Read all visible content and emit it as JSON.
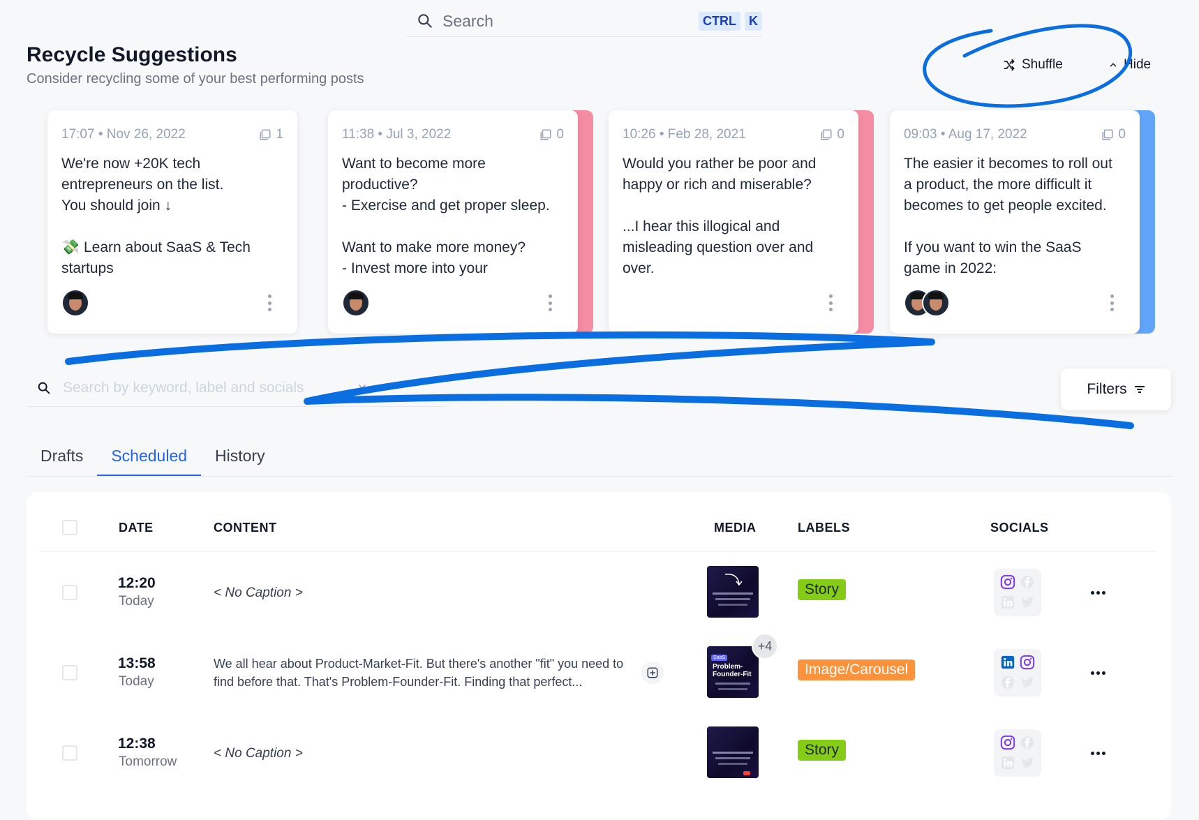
{
  "topbar": {
    "search_placeholder": "Search",
    "shortcut_key1": "CTRL",
    "shortcut_key2": "K"
  },
  "recycle": {
    "title": "Recycle Suggestions",
    "subtitle": "Consider recycling some of your best performing posts",
    "shuffle_label": "Shuffle",
    "hide_label": "Hide",
    "cards": [
      {
        "meta": "17:07 • Nov 26, 2022",
        "media_count": "1",
        "text": "We're now +20K tech\nentrepreneurs on the list.\nYou should join ↓\n\n💸 Learn about SaaS & Tech\nstartups",
        "accent": ""
      },
      {
        "meta": "11:38 • Jul 3, 2022",
        "media_count": "0",
        "text": "Want to become more\nproductive?\n- Exercise and get proper sleep.\n\nWant to make more money?\n- Invest more into your",
        "accent": "#f48ca3"
      },
      {
        "meta": "10:26 • Feb 28, 2021",
        "media_count": "0",
        "text": "Would you rather be poor and\nhappy or rich and miserable?\n\n...I hear this illogical and\nmisleading question over and\nover.",
        "accent": "#f48ca3"
      },
      {
        "meta": "09:03 • Aug 17, 2022",
        "media_count": "0",
        "text": "The easier it becomes to roll out\na product, the more difficult it\nbecomes to get people excited.\n\nIf you want to win the SaaS\ngame in 2022:",
        "accent": "#60a5fa"
      }
    ]
  },
  "list_search": {
    "placeholder": "Search by keyword, label and socials"
  },
  "filters_label": "Filters",
  "tabs": [
    {
      "label": "Drafts"
    },
    {
      "label": "Scheduled"
    },
    {
      "label": "History"
    }
  ],
  "table": {
    "headers": {
      "date": "DATE",
      "content": "CONTENT",
      "media": "MEDIA",
      "labels": "LABELS",
      "socials": "SOCIALS"
    },
    "rows": [
      {
        "time": "12:20",
        "day": "Today",
        "content": "< No Caption >",
        "label": "Story"
      },
      {
        "time": "13:58",
        "day": "Today",
        "content": "We all hear about Product-Market-Fit. But there's another \"fit\" you need to find before that. That's Problem-Founder-Fit. Finding that perfect...",
        "label": "Image/Carousel",
        "media_extra": "+4",
        "media_title": "Problem-Founder-Fit",
        "media_tag": "SaaS"
      },
      {
        "time": "12:38",
        "day": "Tomorrow",
        "content": "< No Caption >",
        "label": "Story"
      }
    ]
  },
  "colors": {
    "accent_blue": "#2563eb",
    "annotation_blue": "#0a6de0",
    "label_green": "#84cc16",
    "label_orange": "#fb923c"
  }
}
